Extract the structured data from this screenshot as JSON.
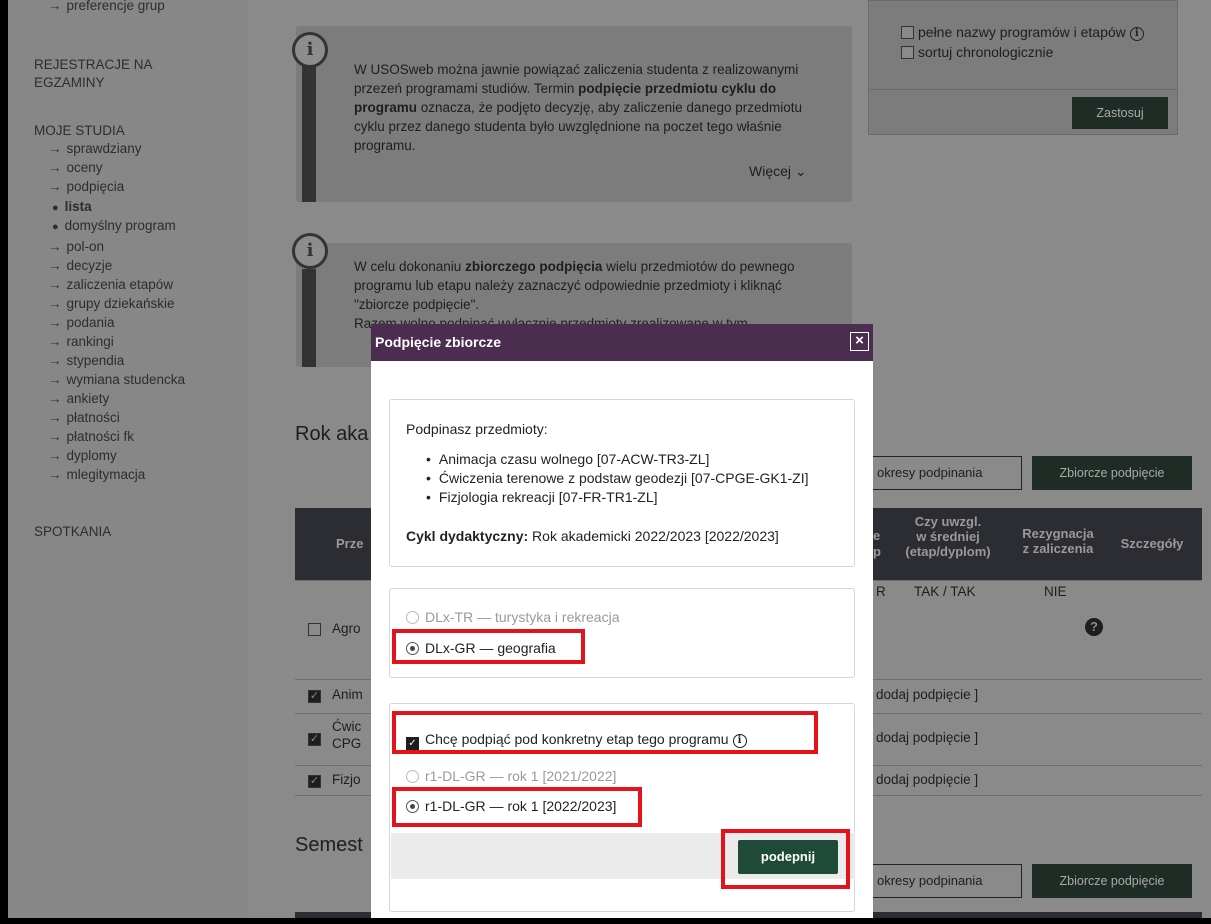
{
  "sidebar": {
    "top_link": "preferencje grup",
    "section_registrations": "REJESTRACJE NA EGZAMINY",
    "section_studies": "MOJE STUDIA",
    "items": [
      {
        "label": "sprawdziany"
      },
      {
        "label": "oceny"
      },
      {
        "label": "podpięcia"
      }
    ],
    "sub_items": [
      {
        "label": "lista"
      },
      {
        "label": "domyślny program"
      }
    ],
    "items2": [
      {
        "label": "pol-on"
      },
      {
        "label": "decyzje"
      },
      {
        "label": "zaliczenia etapów"
      },
      {
        "label": "grupy dziekańskie"
      },
      {
        "label": "podania"
      },
      {
        "label": "rankingi"
      },
      {
        "label": "stypendia"
      },
      {
        "label": "wymiana studencka"
      },
      {
        "label": "ankiety"
      },
      {
        "label": "płatności"
      },
      {
        "label": "płatności fk"
      },
      {
        "label": "dyplomy"
      },
      {
        "label": "mlegitymacja"
      }
    ],
    "section_meetings": "SPOTKANIA"
  },
  "info1": {
    "text_a": "W USOSweb można jawnie powiązać zaliczenia studenta z realizowanymi przezeń programami studiów. Termin ",
    "text_b": "podpięcie przedmiotu cyklu do programu",
    "text_c": " oznacza, że podjęto decyzję, aby zaliczenie danego przedmiotu cyklu przez danego studenta było uwzględnione na poczet tego właśnie programu.",
    "more": "Więcej"
  },
  "info2": {
    "text_a": "W celu dokonaniu ",
    "text_b": "zbiorczego podpięcia",
    "text_c": " wielu przedmiotów do pewnego programu lub etapu należy zaznaczyć odpowiednie przedmioty i kliknąć \"zbiorcze podpięcie\".",
    "text_d": "Razem wolno podpinać wyłącznie przedmioty zrealizowane w tym"
  },
  "options_panel": {
    "opt1": "pełne nazwy programów i etapów",
    "opt2": "sortuj chronologicznie",
    "apply": "Zastosuj"
  },
  "main": {
    "section1_title": "Rok aka",
    "periods_btn": "okresy podpinania",
    "bulk_btn": "Zbiorcze podpięcie",
    "section2_title": "Semest",
    "table": {
      "col_subject": "Prze",
      "col_e": "e",
      "col_p": "p",
      "col_avg_1": "Czy uwzgl.",
      "col_avg_2": "w średniej",
      "col_avg_3": "(etap/dyplom)",
      "col_resign_1": "Rezygnacja",
      "col_resign_2": "z zaliczenia",
      "col_details": "Szczegóły",
      "row1_subject": "Agro",
      "row1_r": "R",
      "row1_avg": "TAK / TAK",
      "row1_resign": "NIE",
      "row2_subject": "Anim",
      "row3_subject_1": "Ćwic",
      "row3_subject_2": "CPG",
      "row4_subject": "Fizjo",
      "add_link": "dodaj podpięcie ]"
    }
  },
  "modal": {
    "title": "Podpięcie zbiorcze",
    "close": "×",
    "courses_label": "Podpinasz przedmioty:",
    "courses": [
      "Animacja czasu wolnego [07-ACW-TR3-ZL]",
      "Ćwiczenia terenowe z podstaw geodezji [07-CPGE-GK1-ZI]",
      "Fizjologia rekreacji [07-FR-TR1-ZL]"
    ],
    "cycle_label": "Cykl dydaktyczny:",
    "cycle_value": " Rok akademicki 2022/2023 [2022/2023]",
    "program_options": [
      {
        "label": "DLx-TR — turystyka i rekreacja",
        "enabled": false,
        "selected": false
      },
      {
        "label": "DLx-GR — geografia",
        "enabled": true,
        "selected": true
      }
    ],
    "stage_checkbox": "Chcę podpiąć pod konkretny etap tego programu",
    "stage_options": [
      {
        "label": "r1-DL-GR — rok 1 [2021/2022]",
        "enabled": false,
        "selected": false
      },
      {
        "label": "r1-DL-GR — rok 1 [2022/2023]",
        "enabled": true,
        "selected": true
      }
    ],
    "submit": "podepnij"
  },
  "colors": {
    "modal_header": "#4b2d4f",
    "submit_button": "#1f4a38",
    "highlight": "#e3121b"
  }
}
